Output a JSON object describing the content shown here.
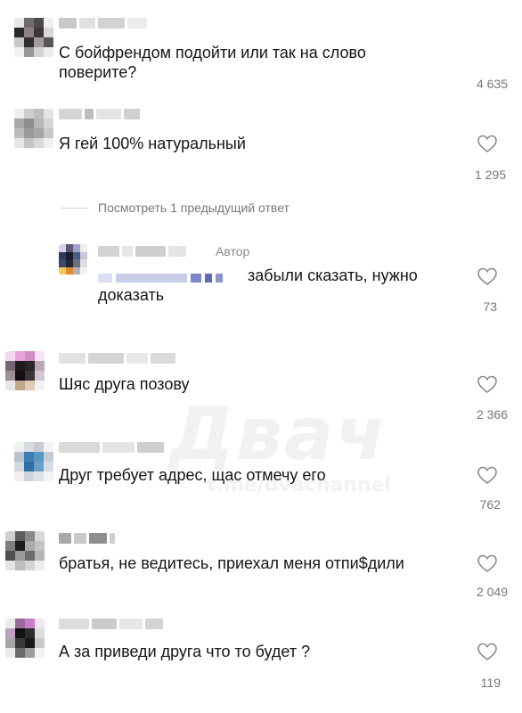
{
  "watermark": {
    "brand": "Двач",
    "handle": "t.me/dvachannel"
  },
  "thread": {
    "view_replies": "Посмотреть 1 предыдущий ответ",
    "author_tag": "Автор"
  },
  "comments": [
    {
      "text": "С бойфрендом подойти или так на слово поверите?",
      "likes": "4 635"
    },
    {
      "text": "Я гей 100% натуральный",
      "likes": "1 295"
    },
    {
      "text": "забыли сказать, нужно доказать",
      "likes": "73"
    },
    {
      "text": "Шяс друга позову",
      "likes": "2 366"
    },
    {
      "text": "Друг требует адрес, щас отмечу его",
      "likes": "762"
    },
    {
      "text": "братья, не ведитесь, приехал меня отпи$дили",
      "likes": "2 049"
    },
    {
      "text": "А за приведи друга что то будет ?",
      "likes": "119"
    }
  ],
  "icons": {
    "like": "heart-outline-icon"
  },
  "colors": {
    "text": "#151515",
    "meta": "#777777",
    "heart_stroke": "#8a8a8a"
  }
}
